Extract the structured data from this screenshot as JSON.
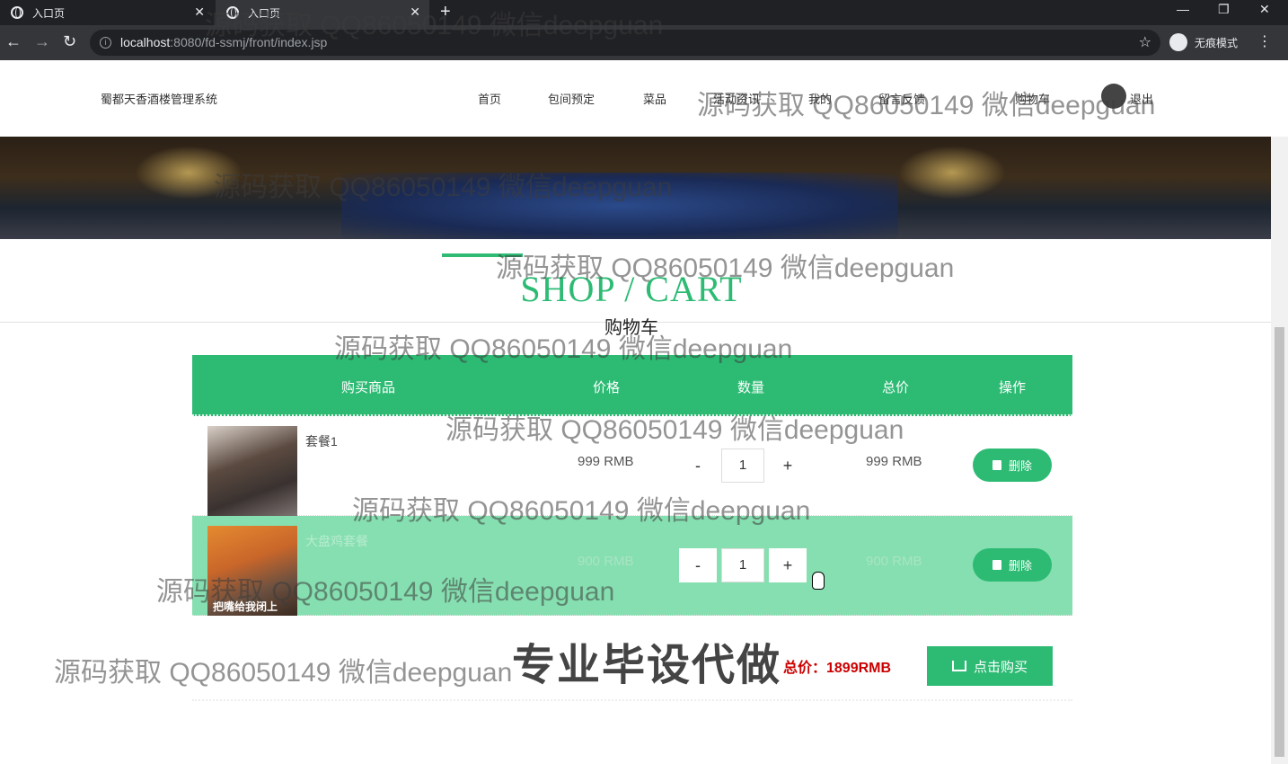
{
  "browser": {
    "tabs": [
      {
        "title": "入口页"
      },
      {
        "title": "入口页"
      }
    ],
    "url_host": "localhost",
    "url_rest": ":8080/fd-ssmj/front/index.jsp",
    "incognito_label": "无痕模式"
  },
  "site": {
    "brand": "蜀都天香酒楼管理系统",
    "nav": [
      "首页",
      "包间预定",
      "菜品",
      "活动资讯",
      "我的",
      "留言反馈",
      "购物车",
      "退出"
    ]
  },
  "section": {
    "title_en": "SHOP / CART",
    "title_cn": "购物车"
  },
  "cart": {
    "headers": {
      "product": "购买商品",
      "price": "价格",
      "qty": "数量",
      "total": "总价",
      "action": "操作"
    },
    "items": [
      {
        "name": "套餐1",
        "price": "999 RMB",
        "qty": "1",
        "total": "999 RMB",
        "delete_label": "删除",
        "thumb_caption": ""
      },
      {
        "name": "大盘鸡套餐",
        "price": "900 RMB",
        "qty": "1",
        "total": "900 RMB",
        "delete_label": "删除",
        "thumb_caption": "把嘴给我闭上"
      }
    ],
    "minus": "-",
    "plus": "+",
    "total_label": "总价：1899RMB",
    "buy_label": "点击购买"
  },
  "watermarks": {
    "text": "源码获取 QQ86050149 微信deepguan",
    "big": "专业毕设代做"
  },
  "colors": {
    "accent": "#2dbb74",
    "total_red": "#cc0000"
  }
}
